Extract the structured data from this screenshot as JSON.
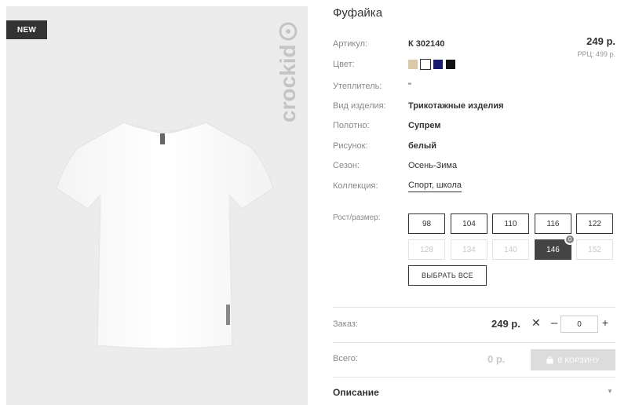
{
  "badge": "NEW",
  "brand": "crockid",
  "product": {
    "title": "Фуфайка"
  },
  "price": {
    "value": "249 р.",
    "rrp": "РРЦ: 499 р."
  },
  "properties": {
    "article": {
      "label": "Артикул:",
      "value": "К 302140"
    },
    "color": {
      "label": "Цвет:",
      "swatches": [
        "#d9c9a8",
        "#ffffff",
        "#1a1a6e",
        "#111111"
      ],
      "selected_index": 1
    },
    "insulation": {
      "label": "Утеплитель:",
      "value": "\""
    },
    "kind": {
      "label": "Вид изделия:",
      "value": "Трикотажные изделия"
    },
    "fabric": {
      "label": "Полотно:",
      "value": "Супрем"
    },
    "print": {
      "label": "Рисунок:",
      "value": "белый"
    },
    "season": {
      "label": "Сезон:",
      "value": "Осень-Зима"
    },
    "collection": {
      "label": "Коллекция:",
      "value": "Спорт, школа"
    }
  },
  "sizes": {
    "label": "Рост/размер:",
    "items": [
      {
        "label": "98",
        "state": "available"
      },
      {
        "label": "104",
        "state": "available"
      },
      {
        "label": "110",
        "state": "available"
      },
      {
        "label": "116",
        "state": "available"
      },
      {
        "label": "122",
        "state": "available"
      },
      {
        "label": "128",
        "state": "disabled"
      },
      {
        "label": "134",
        "state": "disabled"
      },
      {
        "label": "140",
        "state": "disabled"
      },
      {
        "label": "146",
        "state": "selected",
        "count": "0"
      },
      {
        "label": "152",
        "state": "disabled"
      }
    ],
    "select_all": "ВЫБРАТЬ ВСЕ"
  },
  "order": {
    "label": "Заказ:",
    "price": "249 р.",
    "multiply": "✕",
    "minus": "–",
    "quantity": "0",
    "plus": "+"
  },
  "total": {
    "label": "Всего:",
    "value": "0 р.",
    "cart_button": "В КОРЗИНУ"
  },
  "description": {
    "title": "Описание",
    "chevron": "▼"
  },
  "colors": {
    "accent": "#444444",
    "muted": "#888888",
    "photo_bg": "#ececec"
  }
}
